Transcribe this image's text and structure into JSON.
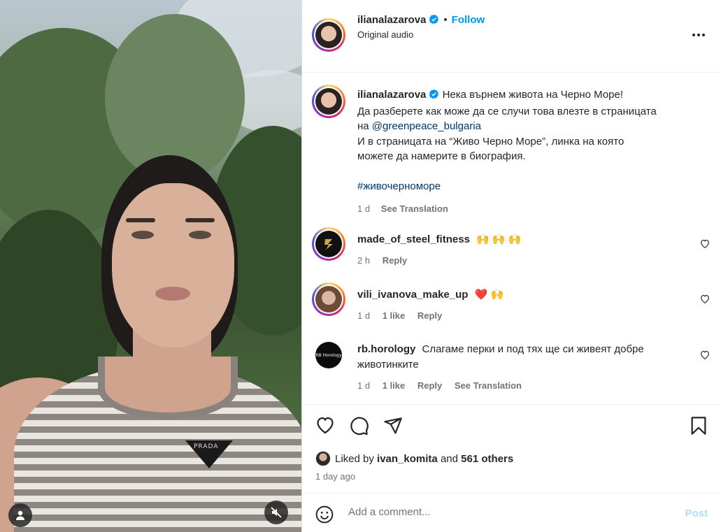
{
  "post": {
    "username": "ilianalazarova",
    "follow_label": "Follow",
    "audio": "Original audio",
    "caption_line1": "Нека върнем живота на Черно Море!",
    "caption_line2": "Да разберете как може да се случи това влезте в страницата",
    "caption_line3_prefix": "на ",
    "caption_mention": "@greenpeace_bulgaria",
    "caption_line4": "И в страницата на “Живо Черно Море”, линка на която",
    "caption_line5": "можете да намерите в биография.",
    "hashtag": "#живочерноморе",
    "time": "1 d",
    "see_translation": "See Translation"
  },
  "comments": [
    {
      "username": "made_of_steel_fitness",
      "text": "🙌 🙌 🙌",
      "time": "2 h",
      "likes": "",
      "reply": "Reply"
    },
    {
      "username": "vili_ivanova_make_up",
      "text": "❤️ 🙌",
      "time": "1 d",
      "likes": "1 like",
      "reply": "Reply"
    },
    {
      "username": "rb.horology",
      "text": "Слагаме перки и под тях ще си живеят добре животинките",
      "time": "1 d",
      "likes": "1 like",
      "reply": "Reply",
      "see_translation": "See Translation",
      "avatar_text": "RB Horology"
    }
  ],
  "likes": {
    "prefix": "Liked by ",
    "user": "ivan_komita",
    "middle": " and ",
    "others": "561 others"
  },
  "time_ago": "1 day ago",
  "add_comment": {
    "placeholder": "Add a comment...",
    "post_label": "Post"
  },
  "video": {
    "logo_text": "PRADA"
  },
  "icons": {
    "more": "more-options-icon",
    "like": "heart-icon",
    "comment": "comment-icon",
    "share": "share-icon",
    "save": "bookmark-icon",
    "emoji": "emoji-icon",
    "mute": "mute-icon",
    "user": "user-icon"
  },
  "colors": {
    "link": "#0095f6",
    "mention": "#00376b",
    "verified": "#0095f6",
    "post_disabled": "#b3dbff"
  }
}
